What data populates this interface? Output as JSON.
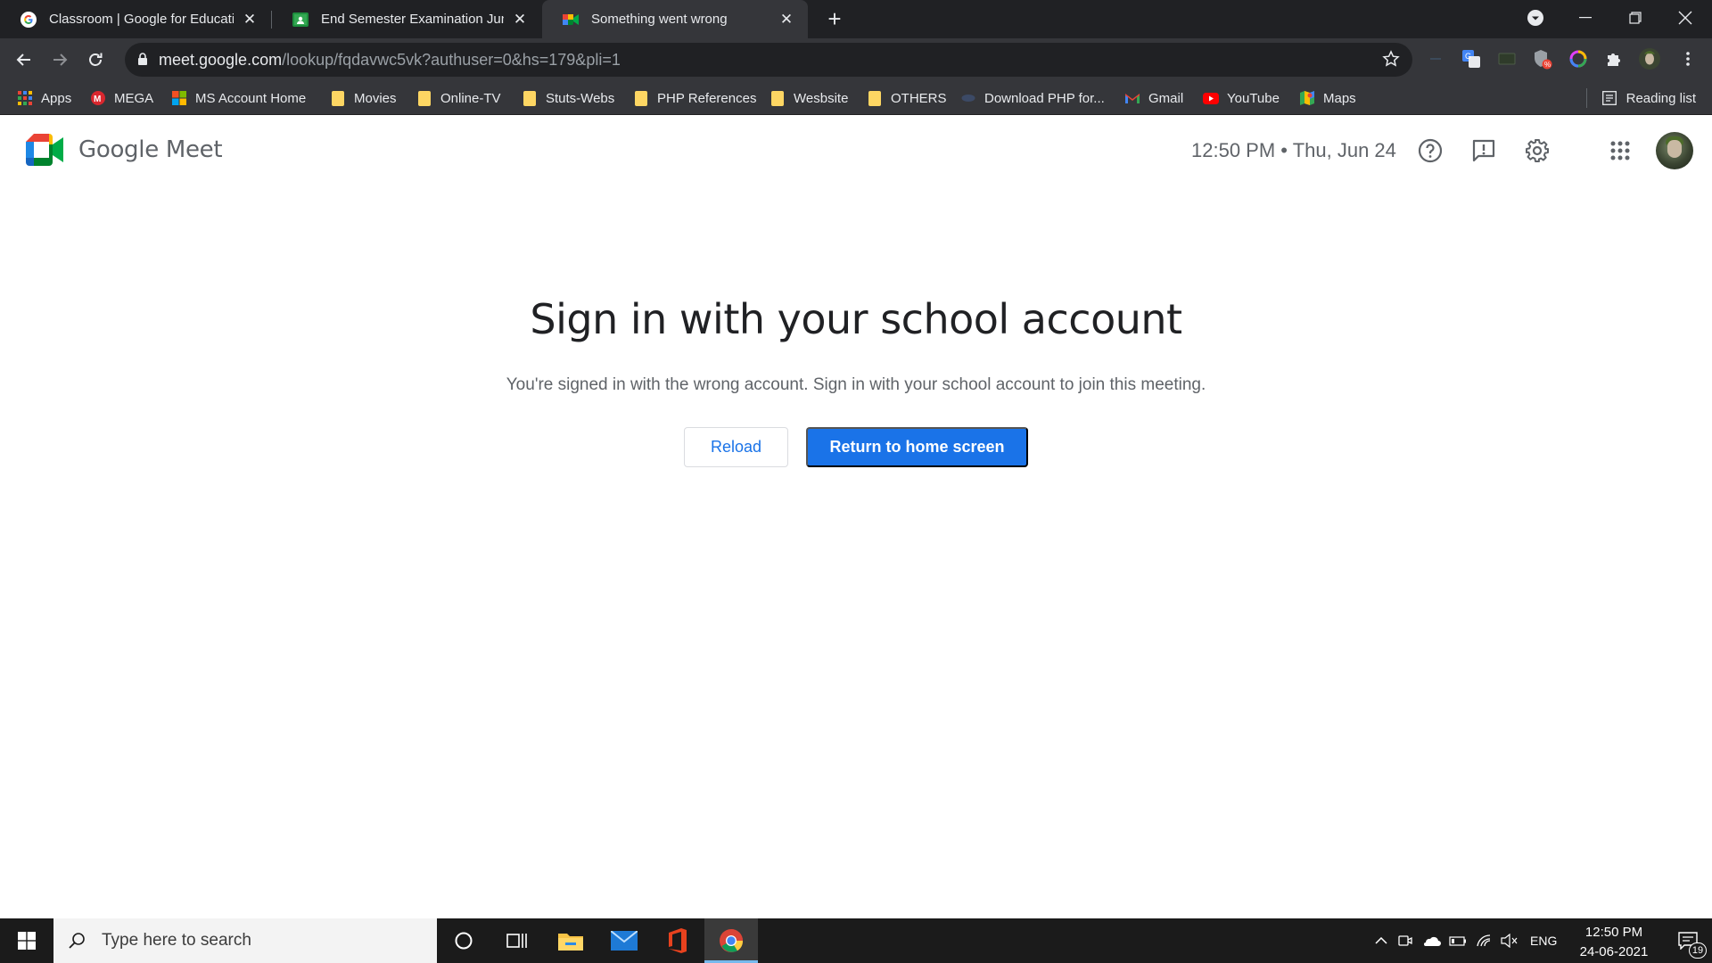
{
  "browser": {
    "tabs": [
      {
        "title": "Classroom | Google for Education",
        "favicon": "google-icon",
        "active": false
      },
      {
        "title": "End Semester Examination June-",
        "favicon": "classroom-icon",
        "active": false
      },
      {
        "title": "Something went wrong",
        "favicon": "meet-icon",
        "active": true
      }
    ],
    "url_host": "meet.google.com",
    "url_path": "/lookup/fqdavwc5vk?authuser=0&hs=179&pli=1",
    "bookmarks": [
      {
        "label": "Apps",
        "icon": "apps-grid-icon"
      },
      {
        "label": "MEGA",
        "icon": "mega-icon"
      },
      {
        "label": "MS Account Home",
        "icon": "microsoft-icon"
      },
      {
        "label": "Movies",
        "icon": "folder-icon"
      },
      {
        "label": "Online-TV",
        "icon": "folder-icon"
      },
      {
        "label": "Stuts-Webs",
        "icon": "folder-icon"
      },
      {
        "label": "PHP References",
        "icon": "folder-icon"
      },
      {
        "label": "Wesbsite",
        "icon": "folder-icon"
      },
      {
        "label": "OTHERS",
        "icon": "folder-icon"
      },
      {
        "label": "Download PHP for...",
        "icon": "php-icon"
      },
      {
        "label": "Gmail",
        "icon": "gmail-icon"
      },
      {
        "label": "YouTube",
        "icon": "youtube-icon"
      },
      {
        "label": "Maps",
        "icon": "maps-icon"
      }
    ],
    "reading_list": "Reading list"
  },
  "meet": {
    "product_name": "Google Meet",
    "clock": "12:50 PM • Thu, Jun 24",
    "headline": "Sign in with your school account",
    "message": "You're signed in with the wrong account. Sign in with your school account to join this meeting.",
    "reload_label": "Reload",
    "home_label": "Return to home screen"
  },
  "taskbar": {
    "search_placeholder": "Type here to search",
    "language": "ENG",
    "time": "12:50 PM",
    "date": "24-06-2021",
    "notification_count": "19"
  },
  "colors": {
    "accent": "#1a73e8",
    "chrome_dark": "#202124",
    "toolbar": "#35363a"
  }
}
